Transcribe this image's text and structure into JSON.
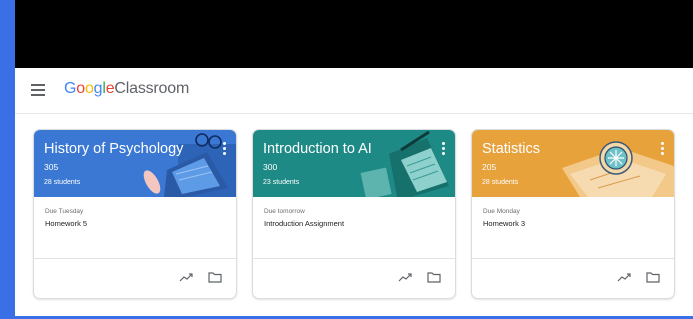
{
  "app": {
    "menu_icon": "hamburger-menu-icon",
    "logo_letters": [
      "G",
      "o",
      "o",
      "g",
      "l",
      "e"
    ],
    "logo_product": "Classroom"
  },
  "colors": {
    "card1": "#3a78d4",
    "card2": "#1d8a86",
    "card3": "#e8a23c"
  },
  "cards": [
    {
      "title": "History of Psychology",
      "section": "305",
      "students": "28 students",
      "due": "Due Tuesday",
      "assignment": "Homework 5"
    },
    {
      "title": "Introduction to AI",
      "section": "300",
      "students": "23 students",
      "due": "Due tomorrow",
      "assignment": "Introduction Assignment"
    },
    {
      "title": "Statistics",
      "section": "205",
      "students": "28 students",
      "due": "Due Monday",
      "assignment": "Homework 3"
    }
  ]
}
